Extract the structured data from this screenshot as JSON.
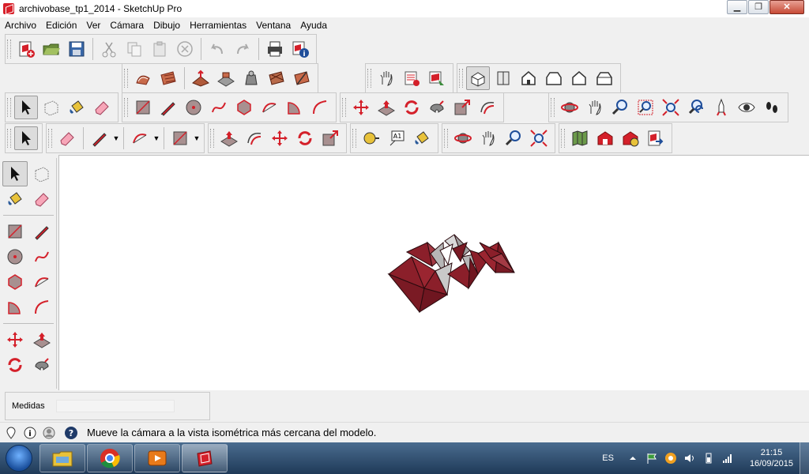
{
  "window": {
    "title": "archivobase_tp1_2014 - SketchUp Pro",
    "minimize": "▁",
    "maximize": "❐",
    "close": "✕"
  },
  "menu": [
    "Archivo",
    "Edición",
    "Ver",
    "Cámara",
    "Dibujo",
    "Herramientas",
    "Ventana",
    "Ayuda"
  ],
  "measurements": {
    "label": "Medidas",
    "value": ""
  },
  "status": {
    "message": "Mueve la cámara a la vista isométrica más cercana del modelo."
  },
  "taskbar": {
    "language": "ES",
    "time": "21:15",
    "date": "16/09/2015"
  },
  "colors": {
    "model_face": "#8b1f2a",
    "model_back": "#b7b7b7",
    "tool_red": "#d4202a",
    "taskbar": "#2a4a6d"
  }
}
